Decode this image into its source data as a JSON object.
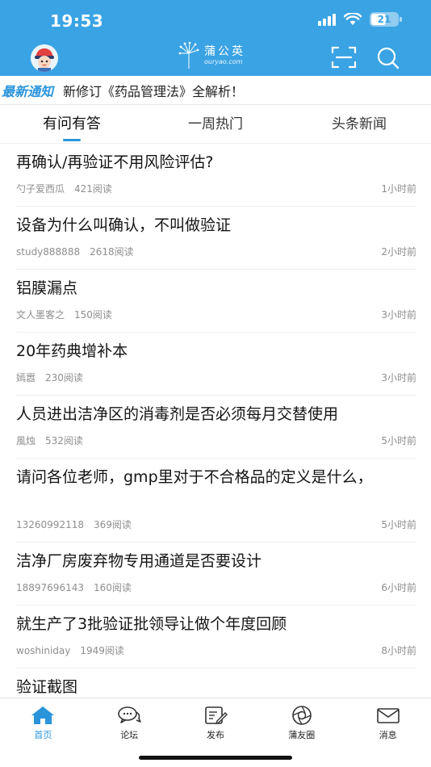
{
  "status_bar": {
    "time": "19:53",
    "battery": "21"
  },
  "header": {
    "logo_cn": "蒲公英",
    "logo_en": "ouryao.com"
  },
  "notice": {
    "label": "最新通知",
    "text": "新修订《药品管理法》全解析！"
  },
  "tabs": [
    {
      "label": "有问有答",
      "active": true
    },
    {
      "label": "一周热门",
      "active": false
    },
    {
      "label": "头条新闻",
      "active": false
    }
  ],
  "posts": [
    {
      "title": "再确认/再验证不用风险评估?",
      "author": "勺子爱西瓜",
      "views": "421阅读",
      "time": "1小时前"
    },
    {
      "title": "设备为什么叫确认，不叫做验证",
      "author": "study888888",
      "views": "2618阅读",
      "time": "2小时前"
    },
    {
      "title": "铝膜漏点",
      "author": "文人墨客之",
      "views": "150阅读",
      "time": "3小时前"
    },
    {
      "title": "20年药典增补本",
      "author": "嫣嚣",
      "views": "230阅读",
      "time": "3小时前"
    },
    {
      "title": "人员进出洁净区的消毒剂是否必须每月交替使用",
      "author": "風烛",
      "views": "532阅读",
      "time": "5小时前"
    },
    {
      "title": "请问各位老师，gmp里对于不合格品的定义是什么，",
      "author": "13260992118",
      "views": "369阅读",
      "time": "5小时前"
    },
    {
      "title": "洁净厂房废弃物专用通道是否要设计",
      "author": "18897696143",
      "views": "160阅读",
      "time": "6小时前"
    },
    {
      "title": "就生产了3批验证批领导让做个年度回顾",
      "author": "woshiniday",
      "views": "1949阅读",
      "time": "8小时前"
    },
    {
      "title": "验证截图"
    }
  ],
  "bottom_nav": [
    {
      "label": "首页",
      "icon": "home-icon",
      "active": true
    },
    {
      "label": "论坛",
      "icon": "forum-icon",
      "active": false
    },
    {
      "label": "发布",
      "icon": "publish-icon",
      "active": false
    },
    {
      "label": "蒲友圈",
      "icon": "friends-circle-icon",
      "active": false
    },
    {
      "label": "消息",
      "icon": "mail-icon",
      "active": false
    }
  ],
  "colors": {
    "primary": "#3aa3e4",
    "accent": "#2b95dc"
  }
}
